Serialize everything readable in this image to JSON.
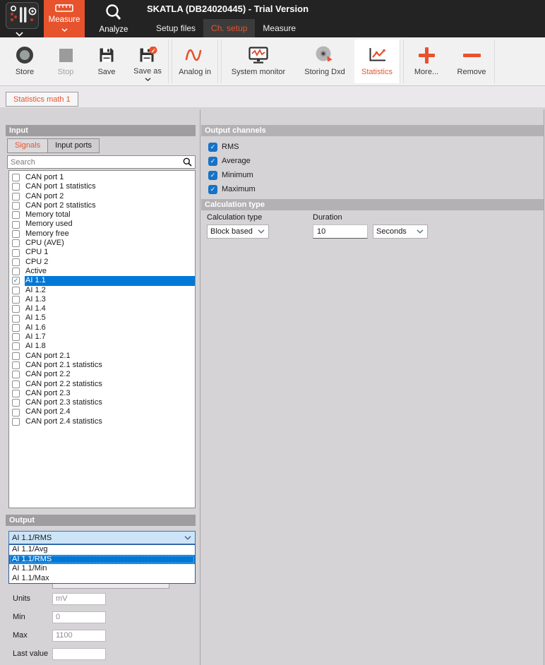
{
  "colors": {
    "accent_orange": "#e6532d",
    "selection_blue": "#0078d7",
    "checkbox_blue": "#1673c6",
    "combobox_focus_bg": "#cce4f7"
  },
  "topbar": {
    "title": "SKATLA (DB24020445) - Trial Version",
    "measure_button": "Measure",
    "analyze_button": "Analyze",
    "nav_tabs": [
      {
        "label": "Setup files",
        "active": false
      },
      {
        "label": "Ch. setup",
        "active": true
      },
      {
        "label": "Measure",
        "active": false
      }
    ]
  },
  "toolbar": {
    "store": "Store",
    "stop": "Stop",
    "save": "Save",
    "save_as": "Save as",
    "analog_in": "Analog in",
    "system_monitor": "System monitor",
    "storing_dxd": "Storing Dxd",
    "statistics": "Statistics",
    "more": "More...",
    "remove": "Remove"
  },
  "module_tab": {
    "label": "Statistics math 1"
  },
  "input_panel": {
    "header": "Input",
    "tabs": [
      {
        "label": "Signals",
        "active": true
      },
      {
        "label": "Input ports",
        "active": false
      }
    ],
    "search_placeholder": "Search",
    "signals": [
      {
        "label": "CAN port 1",
        "checked": false
      },
      {
        "label": "CAN port 1 statistics",
        "checked": false
      },
      {
        "label": "CAN port 2",
        "checked": false
      },
      {
        "label": "CAN port 2 statistics",
        "checked": false
      },
      {
        "label": "Memory total",
        "checked": false
      },
      {
        "label": "Memory used",
        "checked": false
      },
      {
        "label": "Memory free",
        "checked": false
      },
      {
        "label": "CPU (AVE)",
        "checked": false
      },
      {
        "label": "CPU 1",
        "checked": false
      },
      {
        "label": "CPU 2",
        "checked": false
      },
      {
        "label": "Active",
        "checked": false
      },
      {
        "label": "AI 1.1",
        "checked": true,
        "selected": true
      },
      {
        "label": "AI 1.2",
        "checked": false
      },
      {
        "label": "AI 1.3",
        "checked": false
      },
      {
        "label": "AI 1.4",
        "checked": false
      },
      {
        "label": "AI 1.5",
        "checked": false
      },
      {
        "label": "AI 1.6",
        "checked": false
      },
      {
        "label": "AI 1.7",
        "checked": false
      },
      {
        "label": "AI 1.8",
        "checked": false
      },
      {
        "label": "CAN port 2.1",
        "checked": false
      },
      {
        "label": "CAN port 2.1 statistics",
        "checked": false
      },
      {
        "label": "CAN port 2.2",
        "checked": false
      },
      {
        "label": "CAN port 2.2 statistics",
        "checked": false
      },
      {
        "label": "CAN port 2.3",
        "checked": false
      },
      {
        "label": "CAN port 2.3 statistics",
        "checked": false
      },
      {
        "label": "CAN port 2.4",
        "checked": false
      },
      {
        "label": "CAN port 2.4 statistics",
        "checked": false
      }
    ]
  },
  "output_channels": {
    "header": "Output channels",
    "options": [
      {
        "label": "RMS",
        "checked": true
      },
      {
        "label": "Average",
        "checked": true
      },
      {
        "label": "Minimum",
        "checked": true
      },
      {
        "label": "Maximum",
        "checked": true
      }
    ]
  },
  "calculation": {
    "header": "Calculation type",
    "type_label": "Calculation type",
    "type_value": "Block based",
    "duration_label": "Duration",
    "duration_value": "10",
    "duration_unit_value": "Seconds"
  },
  "output_panel": {
    "header": "Output",
    "selected_channel": "AI 1.1/RMS",
    "dropdown_options": [
      {
        "label": "AI 1.1/Avg",
        "selected": false
      },
      {
        "label": "AI 1.1/RMS",
        "selected": true
      },
      {
        "label": "AI 1.1/Min",
        "selected": false
      },
      {
        "label": "AI 1.1/Max",
        "selected": false
      }
    ],
    "fields": [
      {
        "label": "Units",
        "value": "mV"
      },
      {
        "label": "Min",
        "value": "0"
      },
      {
        "label": "Max",
        "value": "1100"
      },
      {
        "label": "Last value",
        "value": ""
      }
    ]
  }
}
